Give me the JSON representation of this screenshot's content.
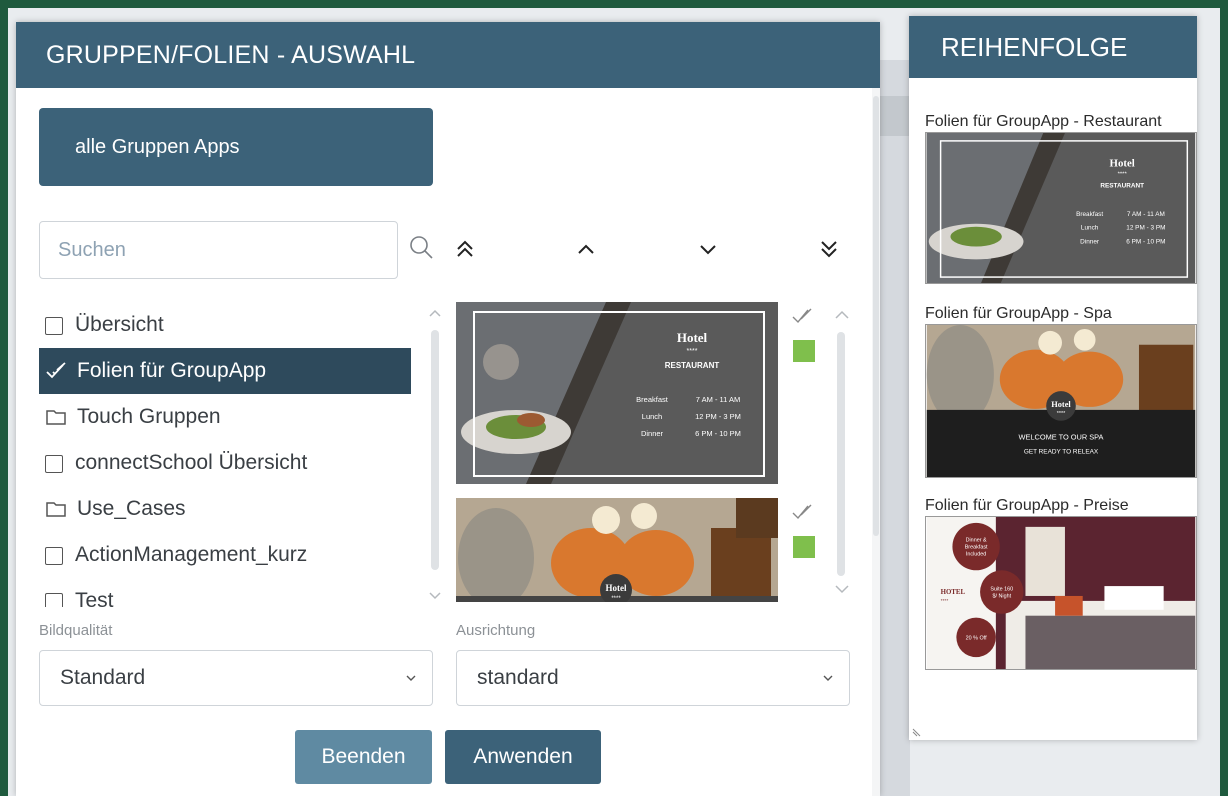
{
  "dialog": {
    "title": "GRUPPEN/FOLIEN - AUSWAHL",
    "all_groups_label": "alle Gruppen Apps",
    "search_placeholder": "Suchen",
    "groups": [
      {
        "label": "Übersicht",
        "type": "checkbox"
      },
      {
        "label": "Folien für GroupApp",
        "type": "checked",
        "selected": true
      },
      {
        "label": "Touch Gruppen",
        "type": "folder"
      },
      {
        "label": "connectSchool Übersicht",
        "type": "checkbox"
      },
      {
        "label": "Use_Cases",
        "type": "folder"
      },
      {
        "label": "ActionManagement_kurz",
        "type": "checkbox"
      },
      {
        "label": "Test",
        "type": "checkbox"
      }
    ],
    "slides": [
      {
        "kind": "restaurant",
        "brand": "Hotel",
        "stars": "****",
        "subtitle": "RESTAURANT",
        "rows": [
          {
            "meal": "Breakfast",
            "time": "7 AM - 11 AM"
          },
          {
            "meal": "Lunch",
            "time": "12 PM - 3 PM"
          },
          {
            "meal": "Dinner",
            "time": "6 PM - 10 PM"
          }
        ]
      },
      {
        "kind": "spa",
        "brand": "Hotel",
        "stars": "****"
      }
    ],
    "quality_label": "Bildqualität",
    "quality_value": "Standard",
    "orientation_label": "Ausrichtung",
    "orientation_value": "standard",
    "close_label": "Beenden",
    "apply_label": "Anwenden"
  },
  "order": {
    "title": "REIHENFOLGE",
    "items": [
      {
        "title": "Folien für GroupApp - Restaurant",
        "brand": "Hotel",
        "stars": "****",
        "subtitle": "RESTAURANT",
        "rows": [
          {
            "meal": "Breakfast",
            "time": "7 AM - 11 AM"
          },
          {
            "meal": "Lunch",
            "time": "12 PM - 3 PM"
          },
          {
            "meal": "Dinner",
            "time": "6 PM - 10 PM"
          }
        ]
      },
      {
        "title": "Folien für GroupApp - Spa",
        "brand": "Hotel",
        "stars": "****",
        "line1": "WELCOME TO OUR SPA",
        "line2": "GET READY TO RELEAX"
      },
      {
        "title": "Folien für GroupApp - Preise",
        "brand": "HOTEL",
        "stars": "****",
        "badge1": "Dinner & Breakfast Included",
        "badge2": "Suite 160 $/ Night",
        "badge3": "20 % Off"
      }
    ]
  },
  "colors": {
    "header": "#3c6279",
    "selected_row": "#2e4a5c",
    "status_ok": "#7fbf4c",
    "frame": "#1f5a3e"
  }
}
